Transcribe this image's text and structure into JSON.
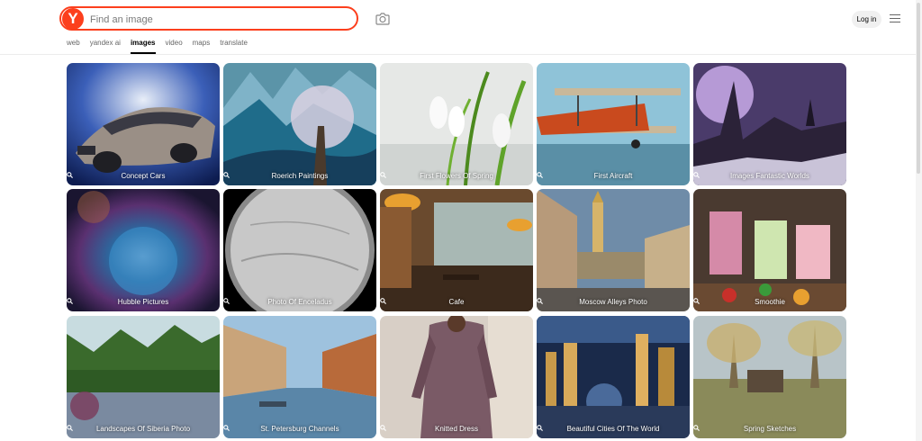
{
  "brand": {
    "logo_letter": "Y",
    "accent": "#fc3f1d"
  },
  "search": {
    "placeholder": "Find an image",
    "value": ""
  },
  "icons": {
    "camera": "camera-search-icon",
    "menu": "hamburger-menu-icon",
    "magnifier": "search-icon"
  },
  "tabs": [
    {
      "label": "web",
      "active": false
    },
    {
      "label": "yandex ai",
      "active": false
    },
    {
      "label": "images",
      "active": true
    },
    {
      "label": "video",
      "active": false
    },
    {
      "label": "maps",
      "active": false
    },
    {
      "label": "translate",
      "active": false
    }
  ],
  "header": {
    "login_label": "Log in"
  },
  "tiles": [
    {
      "caption": "Concept Cars"
    },
    {
      "caption": "Roerich Paintings"
    },
    {
      "caption": "First Flowers Of Spring"
    },
    {
      "caption": "First Aircraft"
    },
    {
      "caption": "Images Fantastic Worlds"
    },
    {
      "caption": "Hubble Pictures"
    },
    {
      "caption": "Photo Of Enceladus"
    },
    {
      "caption": "Cafe"
    },
    {
      "caption": "Moscow Alleys Photo"
    },
    {
      "caption": "Smoothie"
    },
    {
      "caption": "Landscapes Of Siberia Photo"
    },
    {
      "caption": "St. Petersburg Channels"
    },
    {
      "caption": "Knitted Dress"
    },
    {
      "caption": "Beautiful Cities Of The World"
    },
    {
      "caption": "Spring Sketches"
    }
  ]
}
